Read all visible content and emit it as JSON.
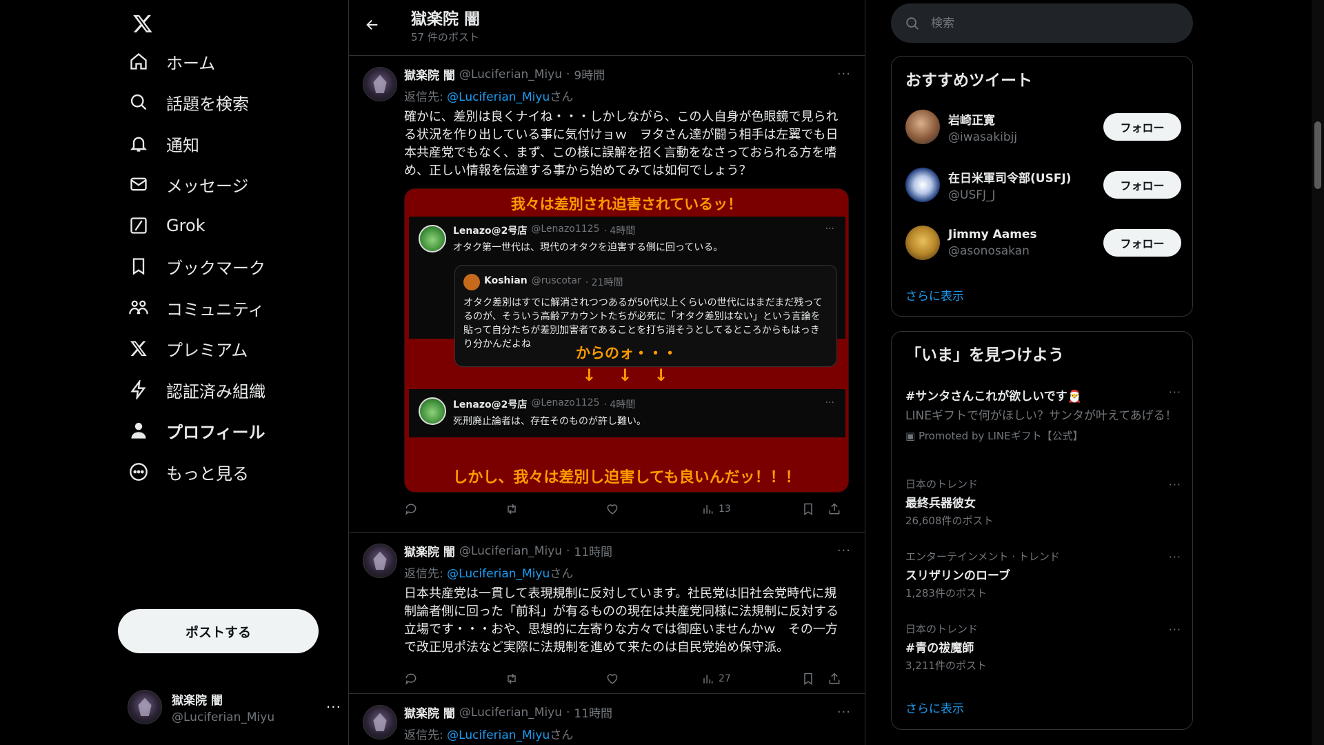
{
  "nav": {
    "items": [
      {
        "label": "ホーム",
        "icon": "home-icon"
      },
      {
        "label": "話題を検索",
        "icon": "search-icon"
      },
      {
        "label": "通知",
        "icon": "bell-icon"
      },
      {
        "label": "メッセージ",
        "icon": "mail-icon"
      },
      {
        "label": "Grok",
        "icon": "grok-icon"
      },
      {
        "label": "ブックマーク",
        "icon": "bookmark-icon"
      },
      {
        "label": "コミュニティ",
        "icon": "community-icon"
      },
      {
        "label": "プレミアム",
        "icon": "x-logo-icon"
      },
      {
        "label": "認証済み組織",
        "icon": "lightning-icon"
      },
      {
        "label": "プロフィール",
        "icon": "person-icon"
      },
      {
        "label": "もっと見る",
        "icon": "more-circle-icon"
      }
    ],
    "post_button": "ポストする",
    "account": {
      "display_name": "獄楽院 闇",
      "handle": "@Luciferian_Miyu",
      "more": "···"
    }
  },
  "header": {
    "title": "獄楽院 闇",
    "subtitle": "57 件のポスト"
  },
  "tweets": [
    {
      "display_name": "獄楽院 闇",
      "handle": "@Luciferian_Miyu",
      "dot": "·",
      "time": "9時間",
      "reply_prefix": "返信先: ",
      "reply_mention": "@Luciferian_Miyu",
      "reply_suffix": "さん",
      "text": "確かに、差別は良くナイね・・・しかしながら、この人自身が色眼鏡で見られる状況を作り出している事に気付けョｗ　ヲタさん達が闘う相手は左翼でも日本共産党でもなく、まず、この様に誤解を招く言動をなさっておられる方を嗜め、正しい情報を伝達する事から始めてみては如何でしょう？",
      "views": "13"
    },
    {
      "display_name": "獄楽院 闇",
      "handle": "@Luciferian_Miyu",
      "dot": "·",
      "time": "11時間",
      "reply_prefix": "返信先: ",
      "reply_mention": "@Luciferian_Miyu",
      "reply_suffix": "さん",
      "text": "日本共産党は一貫して表現規制に反対しています。社民党は旧社会党時代に規制論者側に回った「前科」が有るものの現在は共産党同様に法規制に反対する立場です・・・おや、思想的に左寄りな方々では御座いませんかｗ　その一方で改正児ポ法など実際に法規制を進めて来たのは自民党始め保守派。",
      "views": "27"
    },
    {
      "display_name": "獄楽院 闇",
      "handle": "@Luciferian_Miyu",
      "dot": "·",
      "time": "11時間",
      "reply_prefix": "返信先: ",
      "reply_mention": "@Luciferian_Miyu",
      "reply_suffix": "さん"
    }
  ],
  "media": {
    "top_banner": "我々は差別され迫害されているッ！",
    "embed1": {
      "name": "Lenazo@2号店",
      "handle": "@Lenazo1125",
      "time": "· 4時間",
      "text": "オタク第一世代は、現代のオタクを迫害する側に回っている。",
      "dots": "···"
    },
    "quote": {
      "name": "Koshian",
      "handle": "@ruscotar",
      "time": "· 21時間",
      "text": "オタク差別はすでに解消されつつあるが50代以上くらいの世代にはまだまだ残ってるのが、そういう高齢アカウントたちが必死に「オタク差別はない」という言論を貼って自分たちが差別加害者であることを打ち消そうとしてるところからもはっきり分かんだよね"
    },
    "middle_banner": "からのォ・・・",
    "arrows": "↓　↓　↓",
    "embed2": {
      "name": "Lenazo@2号店",
      "handle": "@Lenazo1125",
      "time": "· 4時間",
      "text": "死刑廃止論者は、存在そのものが許し難い。",
      "dots": "···"
    },
    "bottom_banner": "しかし、我々は差別し迫害しても良いんだッ！！！"
  },
  "right": {
    "search_placeholder": "検索",
    "who_to_follow": {
      "title": "おすすめツイート",
      "users": [
        {
          "name": "岩崎正寛",
          "handle": "@iwasakibjj",
          "button": "フォロー"
        },
        {
          "name": "在日米軍司令部(USFJ)",
          "handle": "@USFJ_J",
          "button": "フォロー"
        },
        {
          "name": "Jimmy Aames",
          "handle": "@asonosakan",
          "button": "フォロー"
        }
      ],
      "more": "さらに表示"
    },
    "trends": {
      "title": "「いま」を見つけよう",
      "promoted": {
        "name": "#サンタさんこれが欲しいです🎅",
        "desc": "LINEギフトで何がほしい？サンタが叶えてあげる！",
        "promoted_by": "Promoted by LINEギフト【公式】"
      },
      "items": [
        {
          "category": "日本のトレンド",
          "name": "最終兵器彼女",
          "posts": "26,608件のポスト"
        },
        {
          "category": "エンターテインメント · トレンド",
          "name": "スリザリンのローブ",
          "posts": "1,283件のポスト"
        },
        {
          "category": "日本のトレンド",
          "name": "#青の祓魔師",
          "posts": "3,211件のポスト"
        }
      ],
      "more": "さらに表示"
    }
  },
  "colors": {
    "accent": "#1d9bf0",
    "background": "#000000",
    "banner_red": "#7a0000",
    "banner_text": "#ff9a00"
  }
}
